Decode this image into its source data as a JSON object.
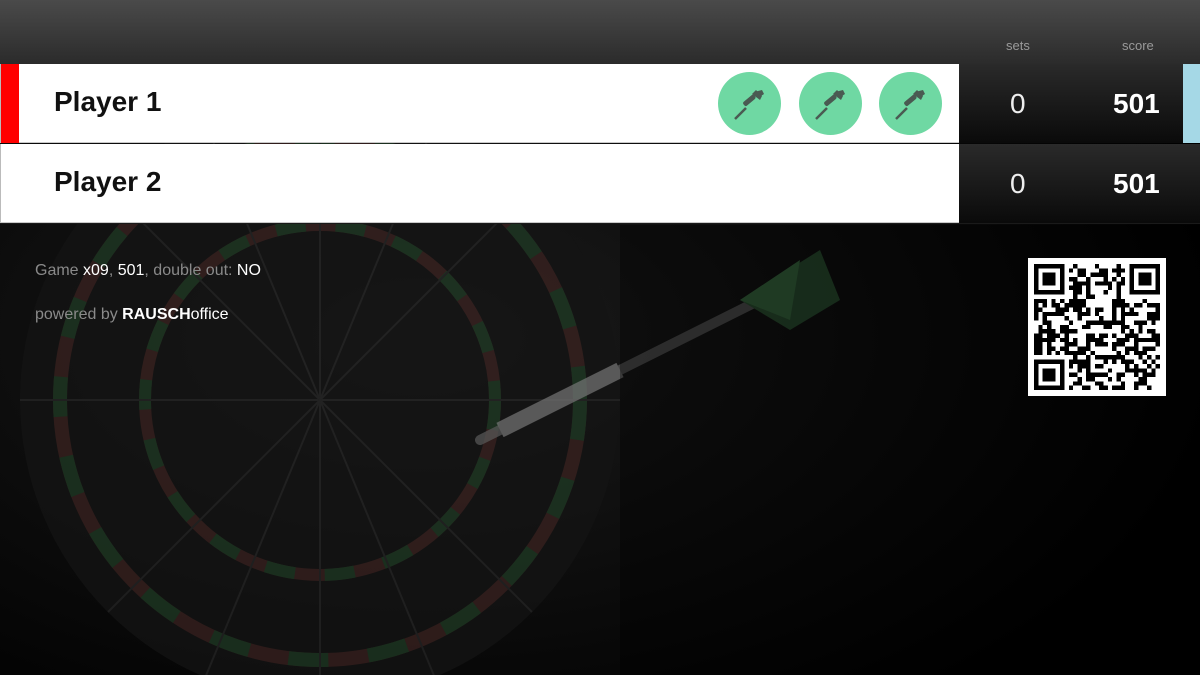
{
  "header": {
    "sets_label": "sets",
    "score_label": "score"
  },
  "players": [
    {
      "name": "Player 1",
      "sets": "0",
      "score": "501",
      "active": true,
      "darts_remaining": 3
    },
    {
      "name": "Player 2",
      "sets": "0",
      "score": "501",
      "active": false,
      "darts_remaining": 0
    }
  ],
  "game_info": {
    "prefix": "Game ",
    "variant": "x09",
    "sep1": ", ",
    "start_score": "501",
    "sep2": ", double out: ",
    "double_out": "NO"
  },
  "powered": {
    "prefix": "powered by ",
    "brand_bold": "RAUSCH",
    "brand_rest": "office"
  },
  "colors": {
    "active_indicator": "#ff0000",
    "dart_bubble": "#6fd8a3",
    "turn_indicator": "#a5d8e6"
  },
  "icons": {
    "dart": "dart-icon",
    "qr": "qr-code"
  }
}
